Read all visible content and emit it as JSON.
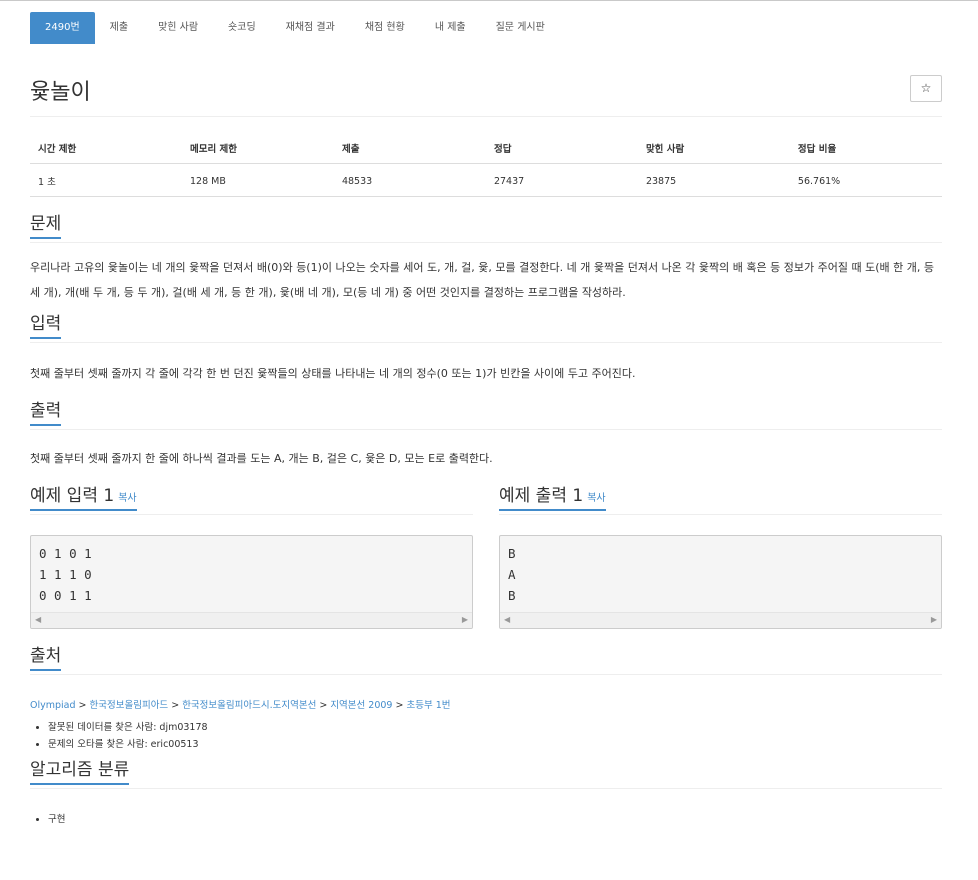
{
  "tabs": [
    "2490번",
    "제출",
    "맞힌 사람",
    "숏코딩",
    "재채점 결과",
    "채점 현황",
    "내 제출",
    "질문 게시판"
  ],
  "title": "윷놀이",
  "star_icon": "☆",
  "stats": {
    "headers": [
      "시간 제한",
      "메모리 제한",
      "제출",
      "정답",
      "맞힌 사람",
      "정답 비율"
    ],
    "values": [
      "1 초",
      "128 MB",
      "48533",
      "27437",
      "23875",
      "56.761%"
    ]
  },
  "sections": {
    "problem": {
      "title": "문제",
      "text": "우리나라 고유의 윷놀이는 네 개의 윷짝을 던져서 배(0)와 등(1)이 나오는 숫자를 세어 도, 개, 걸, 윷, 모를 결정한다. 네 개 윷짝을 던져서 나온 각 윷짝의 배 혹은 등 정보가 주어질 때 도(배 한 개, 등 세 개), 개(배 두 개, 등 두 개), 걸(배 세 개, 등 한 개), 윷(배 네 개), 모(등 네 개) 중 어떤 것인지를 결정하는 프로그램을 작성하라."
    },
    "input": {
      "title": "입력",
      "text": "첫째 줄부터 셋째 줄까지 각 줄에 각각 한 번 던진 윷짝들의 상태를 나타내는 네 개의 정수(0 또는 1)가 빈칸을 사이에 두고 주어진다."
    },
    "output": {
      "title": "출력",
      "text": "첫째 줄부터 셋째 줄까지 한 줄에 하나씩 결과를 도는 A, 개는 B, 걸은 C, 윷은 D, 모는 E로 출력한다."
    },
    "sample_input": {
      "title": "예제 입력 1",
      "copy": "복사",
      "text": "0 1 0 1\n1 1 1 0\n0 0 1 1"
    },
    "sample_output": {
      "title": "예제 출력 1",
      "copy": "복사",
      "text": "B\nA\nB"
    },
    "source": {
      "title": "출처",
      "links": [
        "Olympiad",
        "한국정보올림피아드",
        "한국정보올림피아드시.도지역본선",
        "지역본선 2009"
      ],
      "separator": " > ",
      "tail": "초등부 1번",
      "credits": [
        "잘못된 데이터를 찾은 사람: djm03178",
        "문제의 오타를 찾은 사람: eric00513"
      ]
    },
    "algorithm": {
      "title": "알고리즘 분류",
      "tags": [
        "구현"
      ]
    }
  }
}
